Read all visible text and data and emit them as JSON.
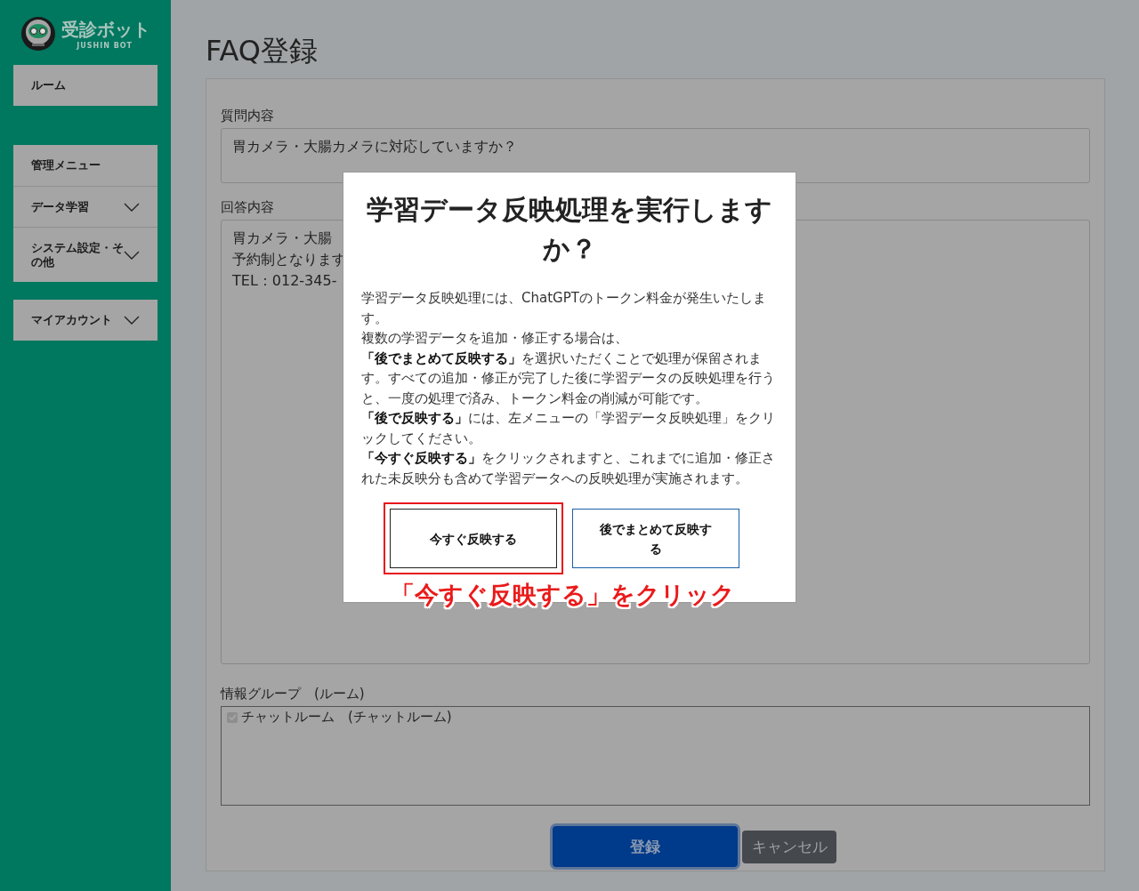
{
  "sidebar": {
    "logo": {
      "name": "受診ボット",
      "subtitle": "JUSHIN BOT"
    },
    "groups": [
      {
        "items": [
          {
            "label": "ルーム",
            "expandable": false
          }
        ]
      },
      {
        "items": [
          {
            "label": "管理メニュー",
            "expandable": false
          },
          {
            "label": "データ学習",
            "expandable": true
          },
          {
            "label": "システム設定・その他",
            "expandable": true
          }
        ]
      },
      {
        "items": [
          {
            "label": "マイアカウント",
            "expandable": true
          }
        ]
      }
    ]
  },
  "page": {
    "title": "FAQ登録"
  },
  "form": {
    "question": {
      "label": "質問内容",
      "value": "胃カメラ・大腸カメラに対応していますか？"
    },
    "answer": {
      "label": "回答内容",
      "lines": [
        "胃カメラ・大腸",
        "予約制となります",
        "TEL：012-345-"
      ]
    },
    "group": {
      "label": "情報グループ　(ルーム)",
      "options": [
        {
          "label": "チャットルーム　(チャットルーム)",
          "checked": true,
          "disabled": true
        }
      ]
    },
    "buttons": [
      {
        "label": "登録",
        "kind": "primary"
      },
      {
        "label": "キャンセル",
        "kind": "secondary"
      }
    ]
  },
  "modal": {
    "title": "学習データ反映処理を実行しますか？",
    "paragraphs": [
      "学習データ反映処理には、ChatGPTのトークン料金が発生いたします。",
      "複数の学習データを追加・修正する場合は、",
      "**「後でまとめて反映する」**を選択いただくことで処理が保留されます。すべての追加・修正が完了した後に学習データの反映処理を行うと、一度の処理で済み、トークン料金の削減が可能です。",
      "**「後で反映する」**には、左メニューの「学習データ反映処理」をクリックしてください。",
      "**「今すぐ反映する」**をクリックされますと、これまでに追加・修正された未反映分も含めて学習データへの反映処理が実施されます。"
    ],
    "buttons": [
      {
        "label": "今すぐ反映する",
        "kind": "primary",
        "highlighted": true
      },
      {
        "label": "後でまとめて反映する",
        "kind": "secondary",
        "highlighted": false
      }
    ],
    "annotation": "「今すぐ反映する」をクリック"
  }
}
